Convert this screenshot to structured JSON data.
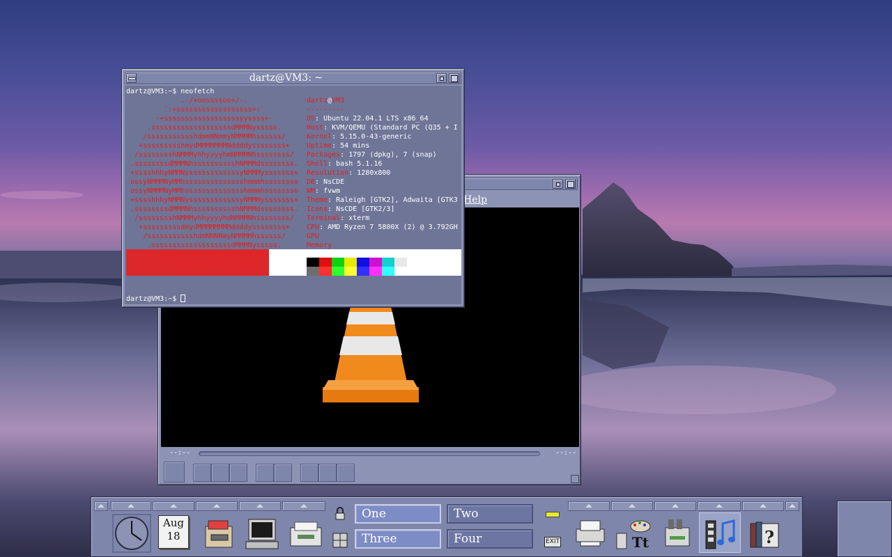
{
  "terminal": {
    "title": "dartz@VM3: ~",
    "command_line": "dartz@VM3:~$ neofetch",
    "prompt_line": "dartz@VM3:~$ ",
    "logo_lines": [
      "             .-/+oossssoo+/-.",
      "         `:+ssssssssssssssssss+:`",
      "       -+ssssssssssssssssssyyssss+-",
      "     .ossssssssssssssssssdMMMNysssso.",
      "    /ssssssssssshdmmNNmmyNMMMMhssssss/",
      "   +ssssssssshmydMMMMMMMNddddyssssssss+",
      "  /sssssssshNMMMyhhyyyyhmNMMMNhssssssss/",
      " .ssssssssdMMMNhsssssssssshNMMMdssssssss.",
      " +sssshhhyNMMNyssssssssssssyNMMMysssssss+",
      " ossyNMMMNyMMhsssssssssssssshmmmhssssssso",
      " ossyNMMMNyMMhsssssssssssssshmmmhssssssso",
      " +sssshhhyNMMNyssssssssssssyNMMMysssssss+",
      " .ssssssssdMMMNhsssssssssshNMMMdssssssss.",
      "  /sssssssshNMMMyhhyyyyhdNMMMNhssssssss/",
      "   +sssssssssdmydMMMMMMMMddddyssssssss+",
      "    /ssssssssssshdmNNNNmyNMMMMhssssss/",
      "     .ossssssssssssssssssdMMMNysssso.",
      "       -+sssssssssssssssssyyyssss+-",
      "         `:+ssssssssssssssssss+:`",
      "             .-/+oossssoo+/-."
    ],
    "user_host_user": "dartz",
    "user_host_at": "@",
    "user_host_host": "VM3",
    "separator": "---------",
    "info": [
      {
        "key": "OS",
        "value": ": Ubuntu 22.04.1 LTS x86_64"
      },
      {
        "key": "Host",
        "value": ": KVM/QEMU (Standard PC (Q35 + I"
      },
      {
        "key": "Kernel",
        "value": ": 5.15.0-43-generic"
      },
      {
        "key": "Uptime",
        "value": ": 54 mins"
      },
      {
        "key": "Packages",
        "value": ": 1797 (dpkg), 7 (snap)"
      },
      {
        "key": "Shell",
        "value": ": bash 5.1.16"
      },
      {
        "key": "Resolution",
        "value": ": 1280x800"
      },
      {
        "key": "DE",
        "value": ": NsCDE"
      },
      {
        "key": "WM",
        "value": ": fvwm"
      },
      {
        "key": "Theme",
        "value": ": Raleigh [GTK2], Adwaita [GTK3"
      },
      {
        "key": "Icons",
        "value": ": NsCDE [GTK2/3]"
      },
      {
        "key": "Terminal",
        "value": ": xterm"
      },
      {
        "key": "CPU",
        "value": ": AMD Ryzen 7 5800X (2) @ 3.792GH"
      },
      {
        "key": "GPU",
        "value": ": 00:01.0 Red Hat, Inc. Virtio GP"
      },
      {
        "key": "Memory",
        "value": ": 477MiB / 7951MiB"
      }
    ],
    "palette_top": [
      "#000000",
      "#e01010",
      "#10d010",
      "#e8e800",
      "#1010e0",
      "#d010d0",
      "#10d0d0",
      "#e8e8e8"
    ],
    "palette_bottom": [
      "#6e6e6e",
      "#ff3030",
      "#30ff30",
      "#ffff30",
      "#3030ff",
      "#ff30ff",
      "#30ffff",
      "#ffffff"
    ]
  },
  "vlc": {
    "menu_help": "Help",
    "time_elapsed": "--:--",
    "time_total": "--:--",
    "cone_colors": {
      "orange": "#f08a1c",
      "white": "#e8e8e8"
    }
  },
  "panel": {
    "calendar_month": "Aug",
    "calendar_day": "18",
    "workspaces": [
      {
        "label": "One",
        "active": true
      },
      {
        "label": "Two",
        "active": false
      },
      {
        "label": "Three",
        "active": true
      },
      {
        "label": "Four",
        "active": false
      }
    ],
    "exit_label": "EXIT",
    "icons": [
      "clock-icon",
      "calendar-icon",
      "file-manager-icon",
      "terminal-icon",
      "mail-icon",
      "lock-icon",
      "workspace-icon",
      "printer-icon",
      "style-manager-icon",
      "app-manager-icon",
      "media-player-icon",
      "help-icon"
    ]
  }
}
